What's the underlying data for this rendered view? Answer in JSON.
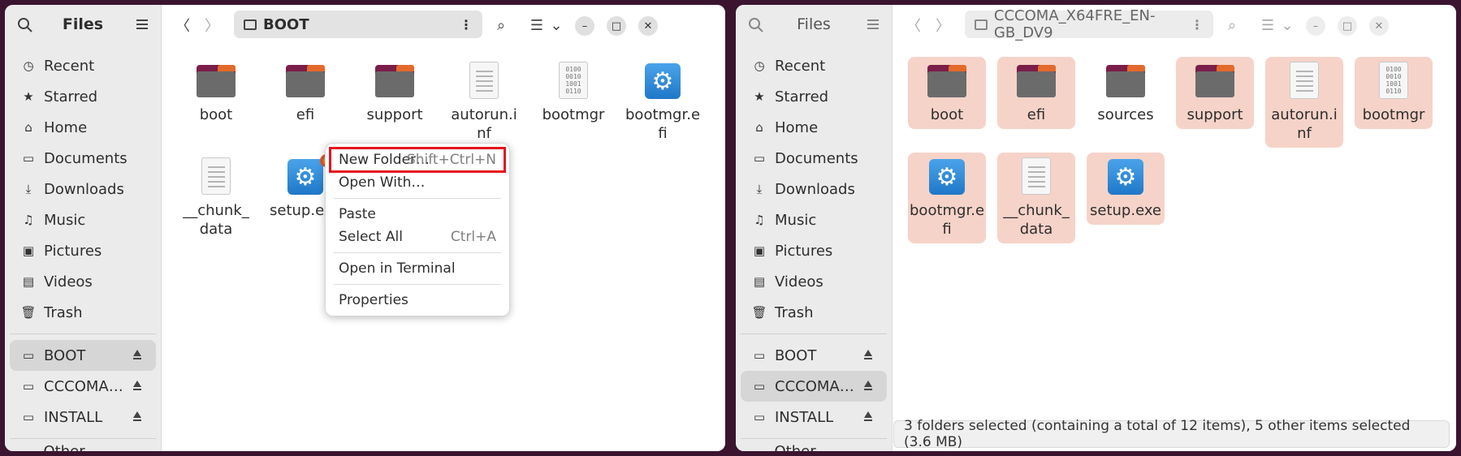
{
  "left": {
    "sidebar": {
      "title": "Files",
      "items": [
        {
          "label": "Recent",
          "icon": "clock-icon"
        },
        {
          "label": "Starred",
          "icon": "star-icon"
        },
        {
          "label": "Home",
          "icon": "home-icon"
        },
        {
          "label": "Documents",
          "icon": "documents-icon"
        },
        {
          "label": "Downloads",
          "icon": "downloads-icon"
        },
        {
          "label": "Music",
          "icon": "music-icon"
        },
        {
          "label": "Pictures",
          "icon": "pictures-icon"
        },
        {
          "label": "Videos",
          "icon": "videos-icon"
        },
        {
          "label": "Trash",
          "icon": "trash-icon"
        }
      ],
      "drives": [
        {
          "label": "BOOT",
          "active": true
        },
        {
          "label": "CCCOMA…",
          "active": false
        },
        {
          "label": "INSTALL",
          "active": false
        }
      ],
      "other": "Other Locations"
    },
    "path": "BOOT",
    "files": [
      {
        "name": "boot",
        "type": "folder"
      },
      {
        "name": "efi",
        "type": "folder"
      },
      {
        "name": "support",
        "type": "folder"
      },
      {
        "name": "autorun.inf",
        "type": "doc"
      },
      {
        "name": "bootmgr",
        "type": "binary"
      },
      {
        "name": "bootmgr.efi",
        "type": "exe"
      },
      {
        "name": "__chunk_data",
        "type": "doc"
      },
      {
        "name": "setup.exe",
        "type": "exe"
      }
    ],
    "context_menu": {
      "new_folder": "New Folder…",
      "new_folder_accel": "Shift+Ctrl+N",
      "open_with": "Open With…",
      "paste": "Paste",
      "select_all": "Select All",
      "select_all_accel": "Ctrl+A",
      "open_terminal": "Open in Terminal",
      "properties": "Properties"
    }
  },
  "right": {
    "sidebar": {
      "title": "Files",
      "items": [
        {
          "label": "Recent"
        },
        {
          "label": "Starred"
        },
        {
          "label": "Home"
        },
        {
          "label": "Documents"
        },
        {
          "label": "Downloads"
        },
        {
          "label": "Music"
        },
        {
          "label": "Pictures"
        },
        {
          "label": "Videos"
        },
        {
          "label": "Trash"
        }
      ],
      "drives": [
        {
          "label": "BOOT"
        },
        {
          "label": "CCCOMA…"
        },
        {
          "label": "INSTALL"
        }
      ],
      "other": "Other Locations"
    },
    "path": "CCCOMA_X64FRE_EN-GB_DV9",
    "files": [
      {
        "name": "boot",
        "type": "folder",
        "selected": true
      },
      {
        "name": "efi",
        "type": "folder",
        "selected": true
      },
      {
        "name": "sources",
        "type": "folder",
        "selected": false
      },
      {
        "name": "support",
        "type": "folder",
        "selected": true
      },
      {
        "name": "autorun.inf",
        "type": "doc",
        "selected": true
      },
      {
        "name": "bootmgr",
        "type": "binary",
        "selected": true
      },
      {
        "name": "bootmgr.efi",
        "type": "exe",
        "selected": true
      },
      {
        "name": "__chunk_data",
        "type": "doc",
        "selected": true
      },
      {
        "name": "setup.exe",
        "type": "exe",
        "selected": true
      }
    ],
    "status": "3 folders selected (containing a total of 12 items), 5 other items selected (3.6 MB)"
  },
  "colors": {
    "selection": "#f6d3c8",
    "highlight_outline": "#e5141f",
    "folder_front": "#6b6b6b",
    "folder_back": "#7a1e4a",
    "folder_tab": "#e46a2c",
    "desktop": "#3b1530"
  }
}
